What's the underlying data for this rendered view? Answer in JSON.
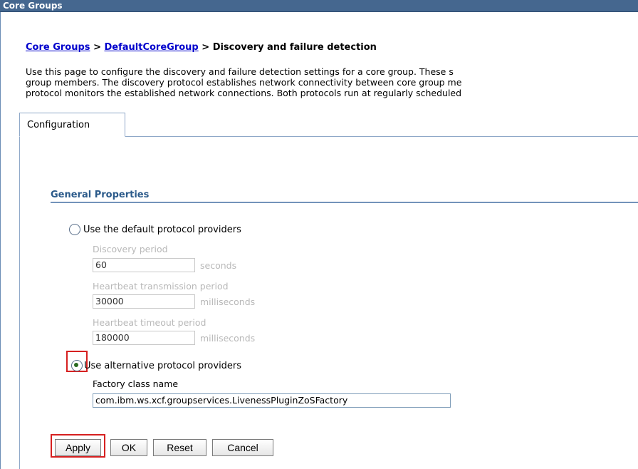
{
  "window": {
    "title": "Core Groups"
  },
  "breadcrumb": {
    "link1": "Core Groups",
    "sep1": " > ",
    "link2": "DefaultCoreGroup",
    "sep2": " > ",
    "current": "Discovery and failure detection"
  },
  "description": {
    "line1": "Use this page to configure the discovery and failure detection settings for a core group. These s",
    "line2": "group members. The discovery protocol establishes network connectivity between core group me",
    "line3": "protocol monitors the established network connections. Both protocols run at regularly scheduled"
  },
  "tabs": [
    {
      "label": "Configuration",
      "selected": true
    }
  ],
  "general_properties": {
    "heading": "General Properties",
    "option_default": {
      "label": "Use the default protocol providers",
      "selected": false
    },
    "discovery_period": {
      "label": "Discovery period",
      "value": "60",
      "unit": "seconds"
    },
    "heartbeat_transmission": {
      "label": "Heartbeat transmission period",
      "value": "30000",
      "unit": "milliseconds"
    },
    "heartbeat_timeout": {
      "label": "Heartbeat timeout period",
      "value": "180000",
      "unit": "milliseconds"
    },
    "option_alternative": {
      "label": "Use alternative protocol providers",
      "selected": true
    },
    "factory_class": {
      "label": "Factory class name",
      "value": "com.ibm.ws.xcf.groupservices.LivenessPluginZoSFactory"
    }
  },
  "buttons": {
    "apply": "Apply",
    "ok": "OK",
    "reset": "Reset",
    "cancel": "Cancel"
  },
  "colors": {
    "titlebar": "#45678f",
    "link": "#0000cc",
    "highlight": "#d62020",
    "heading": "#2b5a8a"
  }
}
